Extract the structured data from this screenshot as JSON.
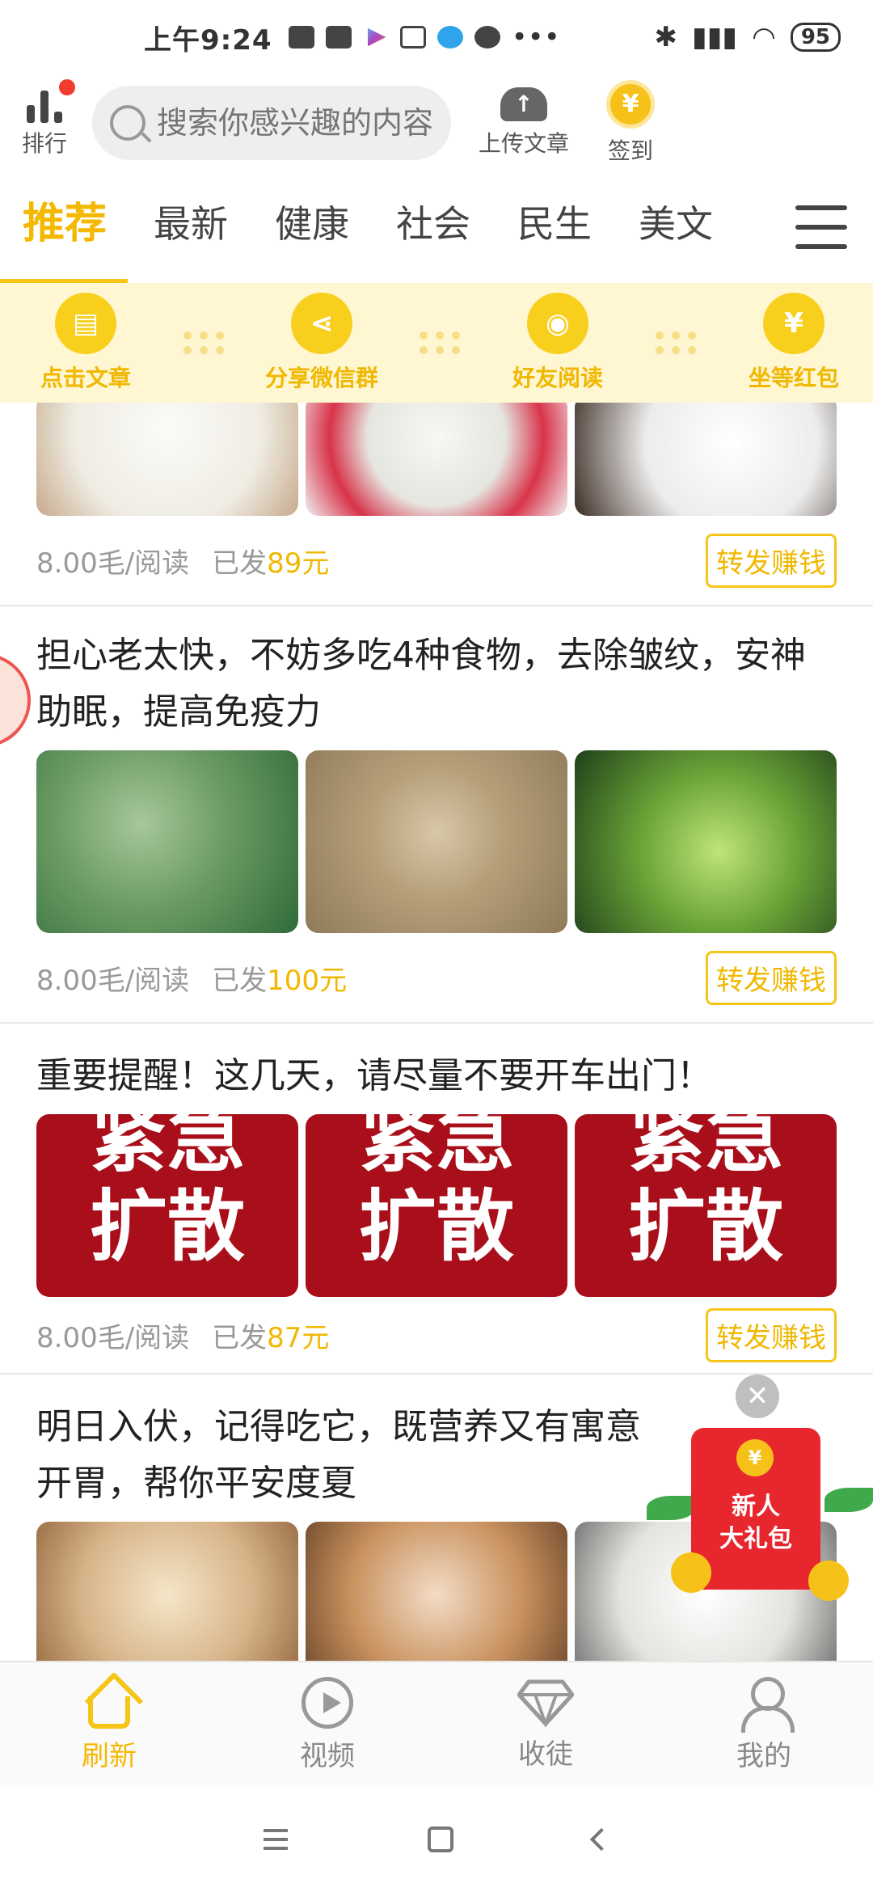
{
  "status_bar": {
    "time": "上午9:24",
    "battery": "95"
  },
  "header": {
    "rank_label": "排行",
    "search_placeholder": "搜索你感兴趣的内容",
    "upload_label": "上传文章",
    "signin_label": "签到",
    "coin_symbol": "¥"
  },
  "tabs": [
    "推荐",
    "最新",
    "健康",
    "社会",
    "民生",
    "美文"
  ],
  "steps": [
    {
      "label": "点击文章",
      "icon": "document-icon"
    },
    {
      "label": "分享微信群",
      "icon": "share-icon"
    },
    {
      "label": "好友阅读",
      "icon": "eye-icon"
    },
    {
      "label": "坐等红包",
      "icon": "red-envelope-icon"
    }
  ],
  "articles": [
    {
      "title": "",
      "rate": "8.00毛/阅读",
      "sent_prefix": "已发",
      "sent_amount": "89元",
      "share_label": "转发赚钱"
    },
    {
      "title": "担心老太快，不妨多吃4种食物，去除皱纹，安神助眠，提高免疫力",
      "rate": "8.00毛/阅读",
      "sent_prefix": "已发",
      "sent_amount": "100元",
      "share_label": "转发赚钱"
    },
    {
      "title": "重要提醒！这几天，请尽量不要开车出门！",
      "image_text_top": "紧急",
      "image_text_bottom": "扩散",
      "rate": "8.00毛/阅读",
      "sent_prefix": "已发",
      "sent_amount": "87元",
      "share_label": "转发赚钱"
    },
    {
      "title": "明日入伏，记得吃它，既营养又有寓意开胃，帮你平安度夏"
    }
  ],
  "gift": {
    "line1": "新人",
    "line2": "大礼包",
    "close": "✕",
    "coin_symbol": "¥"
  },
  "bottom_nav": [
    {
      "label": "刷新",
      "icon": "home-icon",
      "active": true
    },
    {
      "label": "视频",
      "icon": "play-icon",
      "active": false
    },
    {
      "label": "收徒",
      "icon": "diamond-icon",
      "active": false
    },
    {
      "label": "我的",
      "icon": "user-icon",
      "active": false
    }
  ],
  "colors": {
    "accent": "#f5c518",
    "banner_bg": "#fff6d2",
    "red": "#e8262d"
  }
}
